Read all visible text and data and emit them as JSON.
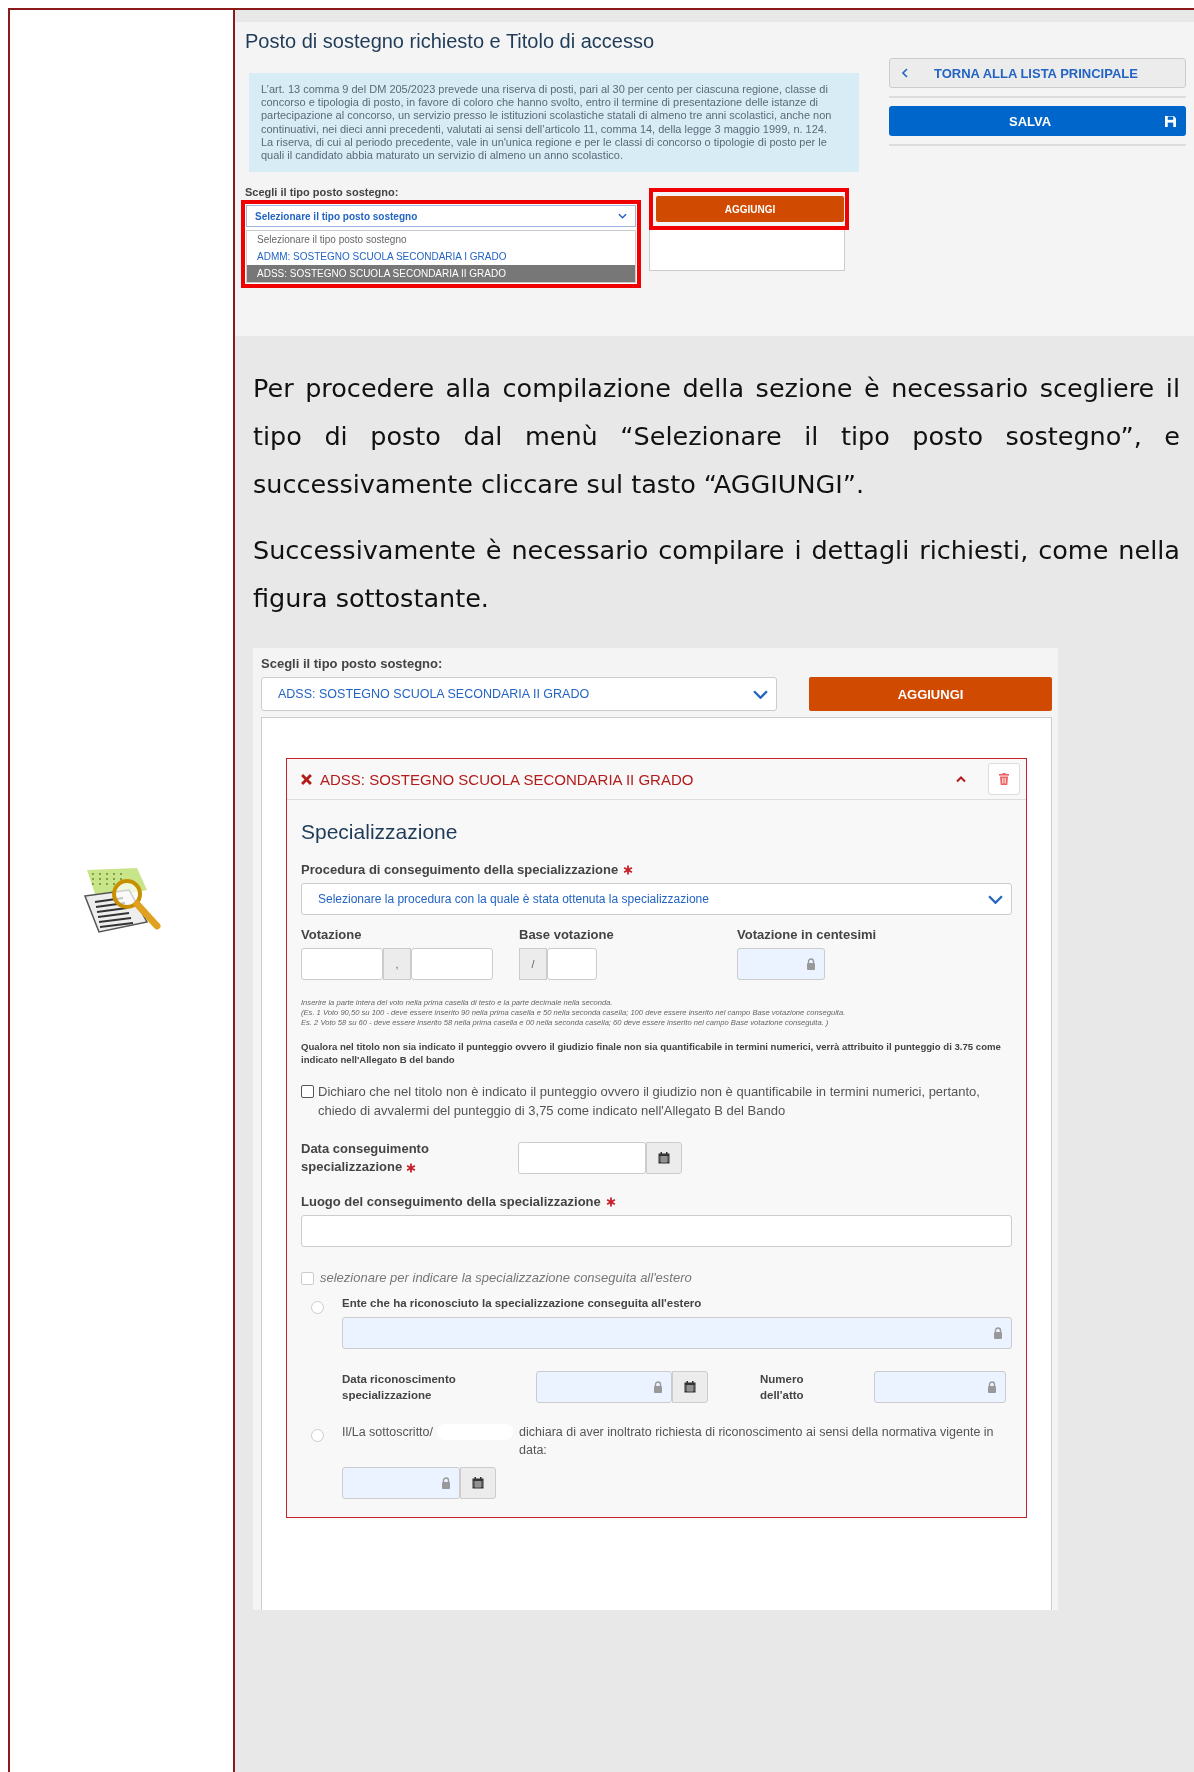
{
  "top_screenshot": {
    "title": "Posto di sostegno richiesto e Titolo di accesso",
    "info_paragraphs": [
      "L’art. 13 comma 9 del DM 205/2023 prevede una riserva di posti, pari al 30 per cento per ciascuna regione, classe di concorso e tipologia di posto, in favore di coloro che hanno svolto, entro il termine di presentazione delle istanze di partecipazione al concorso, un servizio presso le istituzioni scolastiche statali di almeno tre anni scolastici, anche non continuativi, nei dieci anni precedenti, valutati ai sensi dell’articolo 11, comma 14, della legge 3 maggio 1999, n. 124.",
      "La riserva, di cui al periodo precedente, vale in un'unica regione e per le classi di concorso o tipologie di posto per le quali il candidato abbia maturato un servizio di almeno un anno scolastico."
    ],
    "back_button": "TORNA ALLA LISTA PRINCIPALE",
    "save_button": "SALVA",
    "select_label": "Scegli il tipo posto sostegno:",
    "select": {
      "value": "Selezionare il tipo posto sostegno",
      "expanded": true
    },
    "options": [
      {
        "label": "Selezionare il tipo posto sostegno",
        "kind": "placeholder",
        "selected": false
      },
      {
        "label": "ADMM: SOSTEGNO SCUOLA SECONDARIA I GRADO",
        "kind": "option",
        "selected": false
      },
      {
        "label": "ADSS: SOSTEGNO SCUOLA SECONDARIA II GRADO",
        "kind": "option",
        "selected": true
      }
    ],
    "add_button": "AGGIUNGI"
  },
  "instructions": [
    "Per procedere alla compilazione della sezione è necessario scegliere il tipo di posto dal menù “Selezionare il tipo posto sostegno”, e successivamente cliccare sul tasto “AGGIUNGI”.",
    "Successivamente è necessario compilare i dettagli richiesti, come nella figura sottostante."
  ],
  "form_screenshot": {
    "select_label": "Scegli il tipo posto sostegno:",
    "select_value": "ADSS: SOSTEGNO SCUOLA SECONDARIA II GRADO",
    "add_button": "AGGIUNGI",
    "card": {
      "title": "ADSS: SOSTEGNO SCUOLA SECONDARIA II GRADO",
      "expanded": true,
      "section_title": "Specializzazione",
      "procedure": {
        "label": "Procedura di conseguimento della specializzazione",
        "required": true,
        "placeholder": "Selezionare la procedura con la quale è stata ottenuta la specializzazione"
      },
      "grade_label": "Votazione",
      "decimal_separator": ",",
      "base_label": "Base votazione",
      "base_prefix": "/",
      "hundredths_label": "Votazione in centesimi",
      "hint_lines": [
        "Inserire la parte intera del voto nella prima casella di testo e la parte decimale nella seconda.",
        "(Es. 1 Voto 90,50 su 100 - deve essere inserito 90 nella prima casella e 50 nella seconda casella; 100 deve essere inserito nel campo Base votazione conseguita.",
        "Es. 2 Voto 58 su 60 - deve essere inserito 58 nella prima casella e 00 nella seconda casella; 60 deve essere inserito nel campo Base votazione conseguita. )"
      ],
      "note": "Qualora nel titolo non sia indicato il punteggio ovvero il giudizio finale non sia quantificabile in termini numerici, verrà attribuito il punteggio di 3.75 come indicato nell'Allegato B del bando",
      "declaration": {
        "label": "Dichiaro che nel titolo non è indicato il punteggio ovvero il giudizio non è quantificabile in termini numerici, pertanto, chiedo di avvalermi del punteggio di 3,75 come indicato nell'Allegato B del Bando",
        "checked": false
      },
      "date": {
        "label": "Data conseguimento specializzazione",
        "required": true
      },
      "place": {
        "label": "Luogo del conseguimento della specializzazione",
        "required": true
      },
      "abroad": {
        "label": "selezionare per indicare la specializzazione conseguita all'estero",
        "checked": false,
        "disabled": true
      },
      "recognition": {
        "label": "Ente che ha riconosciuto la specializzazione conseguita all'estero",
        "selected": false,
        "date_label": "Data riconoscimento specializzazione",
        "number_label": "Numero dell'atto"
      },
      "request": {
        "text_before": "Il/La sottoscritto/",
        "text_after": "dichiara di aver inoltrato richiesta di riconoscimento ai sensi della normativa vigente in data:",
        "selected": false
      }
    }
  }
}
